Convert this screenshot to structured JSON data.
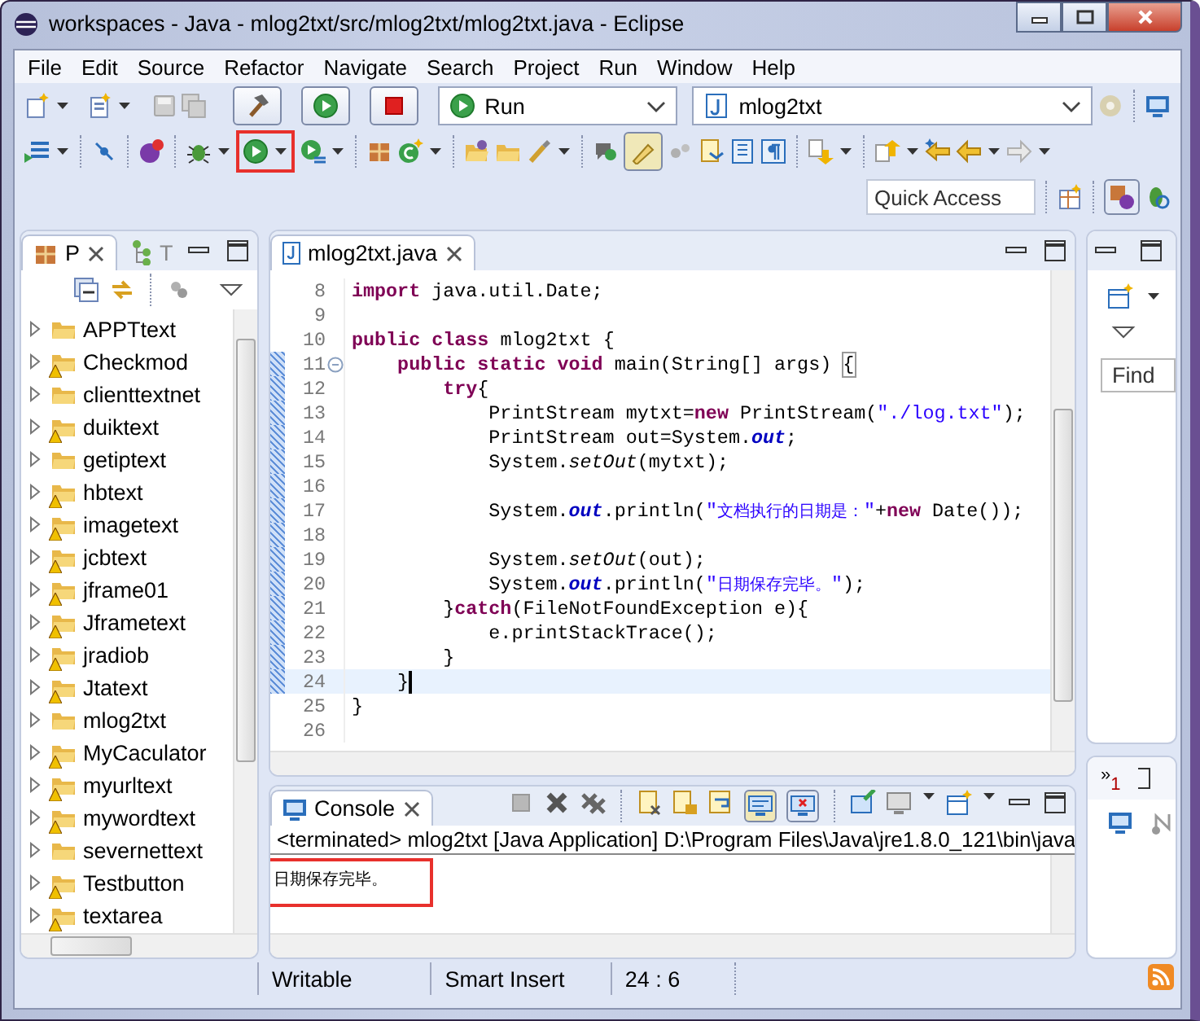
{
  "window": {
    "title": "workspaces - Java - mlog2txt/src/mlog2txt/mlog2txt.java - Eclipse"
  },
  "menu": [
    "File",
    "Edit",
    "Source",
    "Refactor",
    "Navigate",
    "Search",
    "Project",
    "Run",
    "Window",
    "Help"
  ],
  "toolbar": {
    "launch_mode": "Run",
    "launch_config": "mlog2txt",
    "quick_access": {
      "placeholder": "Quick Access"
    }
  },
  "package_explorer": {
    "tabs": [
      {
        "label": "P",
        "selected": true
      },
      {
        "label": "T",
        "selected": false
      }
    ],
    "items": [
      {
        "label": "APPTtext",
        "warning": false,
        "expanded": false
      },
      {
        "label": "Checkmod",
        "warning": true,
        "expanded": false
      },
      {
        "label": "clienttextnet",
        "warning": false,
        "expanded": false
      },
      {
        "label": "duiktext",
        "warning": true,
        "expanded": false
      },
      {
        "label": "getiptext",
        "warning": false,
        "expanded": false
      },
      {
        "label": "hbtext",
        "warning": true,
        "expanded": false
      },
      {
        "label": "imagetext",
        "warning": true,
        "expanded": false
      },
      {
        "label": "jcbtext",
        "warning": true,
        "expanded": false
      },
      {
        "label": "jframe01",
        "warning": true,
        "expanded": false
      },
      {
        "label": "Jframetext",
        "warning": true,
        "expanded": false
      },
      {
        "label": "jradiob",
        "warning": true,
        "expanded": false
      },
      {
        "label": "Jtatext",
        "warning": true,
        "expanded": false
      },
      {
        "label": "mlog2txt",
        "warning": false,
        "expanded": false
      },
      {
        "label": "MyCaculator",
        "warning": true,
        "expanded": false
      },
      {
        "label": "myurltext",
        "warning": true,
        "expanded": false
      },
      {
        "label": "mywordtext",
        "warning": true,
        "expanded": false
      },
      {
        "label": "severnettext",
        "warning": false,
        "expanded": false
      },
      {
        "label": "Testbutton",
        "warning": true,
        "expanded": false
      },
      {
        "label": "textarea",
        "warning": true,
        "expanded": false
      }
    ]
  },
  "editor": {
    "tabs": [
      {
        "label": "mlog2txt.java",
        "selected": true
      }
    ],
    "lines": [
      {
        "n": "8",
        "changed": false,
        "current": false,
        "foldable": false,
        "tokens": [
          {
            "kind": "keyword",
            "text": "import"
          },
          {
            "kind": "plain",
            "text": " java.util.Date;"
          }
        ]
      },
      {
        "n": "9",
        "changed": false,
        "current": false,
        "foldable": false
      },
      {
        "n": "10",
        "changed": false,
        "current": false,
        "foldable": false,
        "tokens": [
          {
            "kind": "keyword",
            "text": "public"
          },
          {
            "kind": "keyword",
            "text": " class"
          },
          {
            "kind": "plain",
            "text": " mlog2txt {"
          }
        ]
      },
      {
        "n": "11",
        "changed": true,
        "current": false,
        "foldable": true,
        "tokens": [
          {
            "kind": "keyword",
            "text": "    public"
          },
          {
            "kind": "keyword",
            "text": " static"
          },
          {
            "kind": "keyword",
            "text": " void"
          },
          {
            "kind": "plain",
            "text": " main(String[] args) "
          },
          {
            "kind": "bracket_match",
            "text": "{"
          }
        ]
      },
      {
        "n": "12",
        "changed": true,
        "current": false,
        "foldable": false,
        "tokens": [
          {
            "kind": "keyword",
            "text": "        try"
          },
          {
            "kind": "plain",
            "text": "{"
          }
        ]
      },
      {
        "n": "13",
        "changed": true,
        "current": false,
        "foldable": false,
        "tokens": [
          {
            "kind": "plain",
            "text": "            PrintStream mytxt="
          },
          {
            "kind": "keyword",
            "text": "new"
          },
          {
            "kind": "plain",
            "text": " PrintStream("
          },
          {
            "kind": "string",
            "text": "\"./log.txt\""
          },
          {
            "kind": "plain",
            "text": ");"
          }
        ]
      },
      {
        "n": "14",
        "changed": true,
        "current": false,
        "foldable": false,
        "tokens": [
          {
            "kind": "plain",
            "text": "            PrintStream out=System."
          },
          {
            "kind": "field",
            "text": "out"
          },
          {
            "kind": "plain",
            "text": ";"
          }
        ]
      },
      {
        "n": "15",
        "changed": true,
        "current": false,
        "foldable": false,
        "tokens": [
          {
            "kind": "plain",
            "text": "            System."
          },
          {
            "kind": "static_call",
            "text": "setOut"
          },
          {
            "kind": "plain",
            "text": "(mytxt);"
          }
        ]
      },
      {
        "n": "16",
        "changed": true,
        "current": false,
        "foldable": false
      },
      {
        "n": "17",
        "changed": true,
        "current": false,
        "foldable": false,
        "tokens": [
          {
            "kind": "plain",
            "text": "            System."
          },
          {
            "kind": "field",
            "text": "out"
          },
          {
            "kind": "plain",
            "text": ".println("
          },
          {
            "kind": "string",
            "text": "\""
          },
          {
            "kind": "string_cjk",
            "text": "文档执行的日期是："
          },
          {
            "kind": "string",
            "text": "\""
          },
          {
            "kind": "plain",
            "text": "+"
          },
          {
            "kind": "keyword",
            "text": "new"
          },
          {
            "kind": "plain",
            "text": " Date());"
          }
        ]
      },
      {
        "n": "18",
        "changed": true,
        "current": false,
        "foldable": false
      },
      {
        "n": "19",
        "changed": true,
        "current": false,
        "foldable": false,
        "tokens": [
          {
            "kind": "plain",
            "text": "            System."
          },
          {
            "kind": "static_call",
            "text": "setOut"
          },
          {
            "kind": "plain",
            "text": "(out);"
          }
        ]
      },
      {
        "n": "20",
        "changed": true,
        "current": false,
        "foldable": false,
        "tokens": [
          {
            "kind": "plain",
            "text": "            System."
          },
          {
            "kind": "field",
            "text": "out"
          },
          {
            "kind": "plain",
            "text": ".println("
          },
          {
            "kind": "string",
            "text": "\""
          },
          {
            "kind": "string_cjk",
            "text": "日期保存完毕。"
          },
          {
            "kind": "string",
            "text": "\""
          },
          {
            "kind": "plain",
            "text": ");"
          }
        ]
      },
      {
        "n": "21",
        "changed": true,
        "current": false,
        "foldable": false,
        "tokens": [
          {
            "kind": "plain",
            "text": "        }"
          },
          {
            "kind": "keyword",
            "text": "catch"
          },
          {
            "kind": "plain",
            "text": "(FileNotFoundException e){"
          }
        ]
      },
      {
        "n": "22",
        "changed": true,
        "current": false,
        "foldable": false,
        "tokens": [
          {
            "kind": "plain",
            "text": "            e.printStackTrace();"
          }
        ]
      },
      {
        "n": "23",
        "changed": true,
        "current": false,
        "foldable": false,
        "tokens": [
          {
            "kind": "plain",
            "text": "        }"
          }
        ]
      },
      {
        "n": "24",
        "changed": true,
        "current": true,
        "foldable": false,
        "tokens": [
          {
            "kind": "plain",
            "text": "    }"
          }
        ]
      },
      {
        "n": "25",
        "changed": false,
        "current": false,
        "foldable": false,
        "tokens": [
          {
            "kind": "plain",
            "text": "}"
          }
        ]
      },
      {
        "n": "26",
        "changed": false,
        "current": false,
        "foldable": false
      }
    ]
  },
  "console": {
    "tab": {
      "label": "Console",
      "selected": true
    },
    "status": "<terminated> mlog2txt [Java Application] D:\\Program Files\\Java\\jre1.8.0_121\\bin\\java",
    "output": [
      {
        "text": "日期保存完毕。",
        "highlighted": true
      }
    ]
  },
  "right_panel": {
    "find": {
      "placeholder": "Find"
    },
    "overflow": {
      "symbol": "»",
      "count": "1"
    }
  },
  "status_bar": {
    "mode": "Writable",
    "insert_mode": "Smart Insert",
    "position": "24 : 6"
  }
}
